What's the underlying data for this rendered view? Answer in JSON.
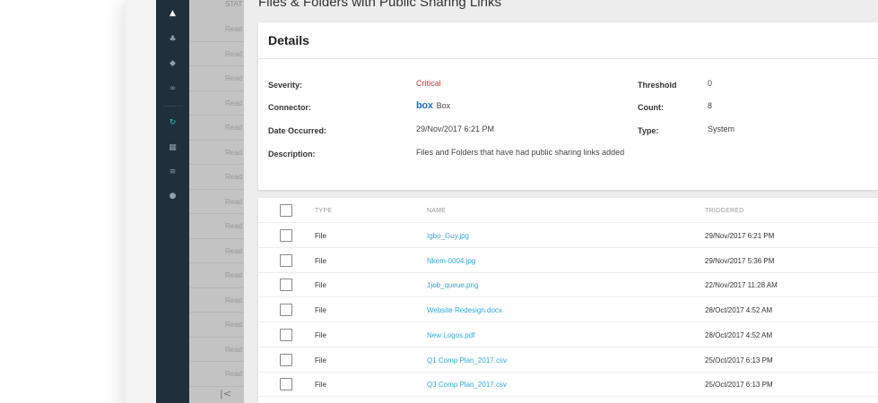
{
  "panel": {
    "title": "Files & Folders with Public Sharing Links"
  },
  "left_list": {
    "header": "STAT",
    "rows": [
      "Read",
      "Read",
      "Read",
      "Read",
      "Read",
      "Read",
      "Read",
      "Read",
      "Read",
      "Read",
      "Read",
      "Read",
      "Read",
      "Read",
      "Read"
    ]
  },
  "nav": {
    "icons": [
      "bell-icon",
      "users-icon",
      "layers-icon",
      "link-icon",
      "refresh-icon",
      "grid-icon",
      "list-icon",
      "chat-icon"
    ]
  },
  "details": {
    "title": "Details",
    "severity_label": "Severity:",
    "severity_value": "Critical",
    "connector_label": "Connector:",
    "connector_logo": "box",
    "connector_value": "Box",
    "date_label": "Date Occurred:",
    "date_value": "29/Nov/2017 6:21 PM",
    "description_label": "Description:",
    "description_value": "Files and Folders that have had public sharing links added",
    "threshold_label": "Threshold",
    "threshold_value": "0",
    "count_label": "Count:",
    "count_value": "8",
    "type_label": "Type:",
    "type_value": "System"
  },
  "table": {
    "columns": {
      "type": "TYPE",
      "name": "NAME",
      "triggered": "TRIGGERED"
    },
    "rows": [
      {
        "type": "File",
        "name": "Igbo_Guy.jpg",
        "triggered": "29/Nov/2017 6:21 PM"
      },
      {
        "type": "File",
        "name": "Nkem-0004.jpg",
        "triggered": "29/Nov/2017 5:36 PM"
      },
      {
        "type": "File",
        "name": "1job_queue.png",
        "triggered": "22/Nov/2017 11:28 AM"
      },
      {
        "type": "File",
        "name": "Website Redesign.docx",
        "triggered": "28/Oct/2017 4:52 AM"
      },
      {
        "type": "File",
        "name": "New Logos.pdf",
        "triggered": "28/Oct/2017 4:52 AM"
      },
      {
        "type": "File",
        "name": "Q1 Comp Plan_2017.csv",
        "triggered": "25/Oct/2017 6:13 PM"
      },
      {
        "type": "File",
        "name": "Q3 Comp Plan_2017.csv",
        "triggered": "25/Oct/2017 6:13 PM"
      }
    ]
  },
  "colors": {
    "nav_bg": "#1f2f3b",
    "critical": "#e0303a",
    "link": "#2fa8dc",
    "accent_teal": "#38c6c6"
  }
}
